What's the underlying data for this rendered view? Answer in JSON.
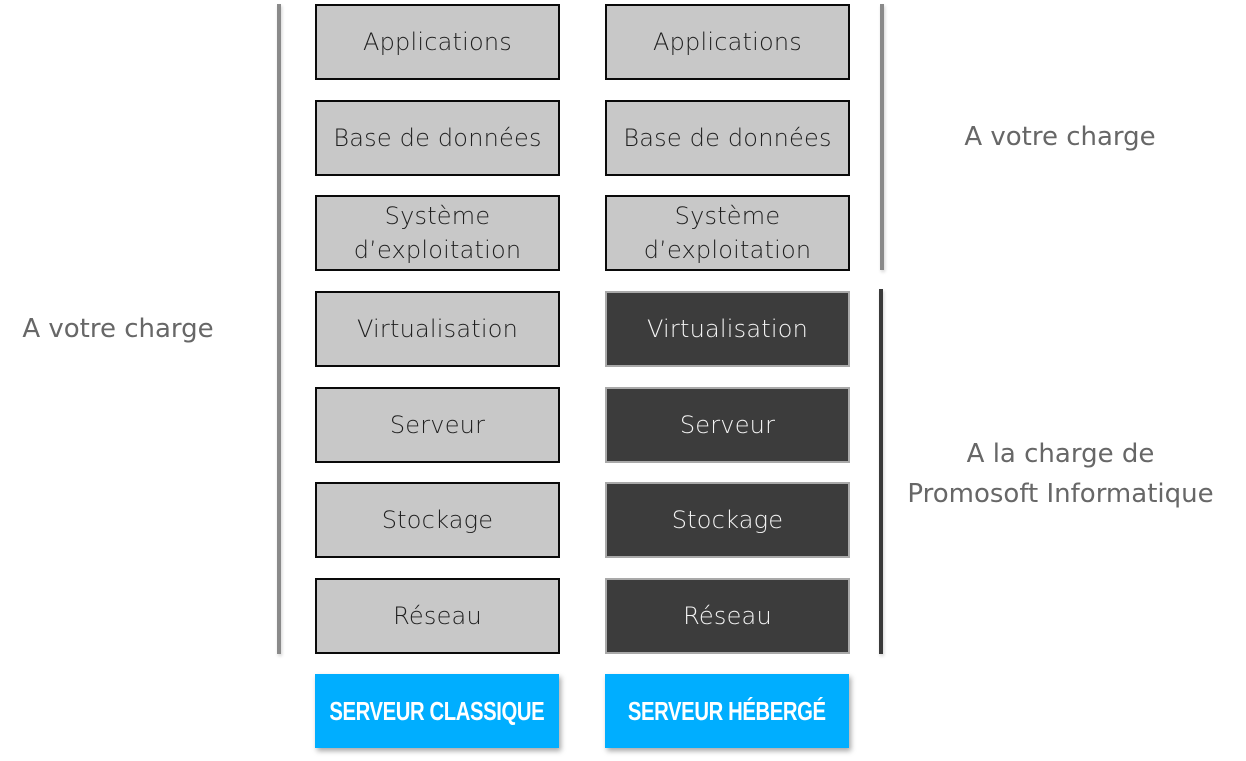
{
  "columns": [
    {
      "title": "SERVEUR CLASSIQUE",
      "layers": [
        {
          "label": "Applications",
          "responsibility": "client"
        },
        {
          "label": "Base de données",
          "responsibility": "client"
        },
        {
          "label": "Système\nd’exploitation",
          "responsibility": "client"
        },
        {
          "label": "Virtualisation",
          "responsibility": "client"
        },
        {
          "label": "Serveur",
          "responsibility": "client"
        },
        {
          "label": "Stockage",
          "responsibility": "client"
        },
        {
          "label": "Réseau",
          "responsibility": "client"
        }
      ]
    },
    {
      "title": "SERVEUR HÉBERGÉ",
      "layers": [
        {
          "label": "Applications",
          "responsibility": "client"
        },
        {
          "label": "Base de données",
          "responsibility": "client"
        },
        {
          "label": "Système\nd’exploitation",
          "responsibility": "client"
        },
        {
          "label": "Virtualisation",
          "responsibility": "provider"
        },
        {
          "label": "Serveur",
          "responsibility": "provider"
        },
        {
          "label": "Stockage",
          "responsibility": "provider"
        },
        {
          "label": "Réseau",
          "responsibility": "provider"
        }
      ]
    }
  ],
  "labels": {
    "left": "A votre charge",
    "right_top": "A votre charge",
    "right_bottom_line1": "A la charge de",
    "right_bottom_line2": "Promosoft Informatique"
  },
  "colors": {
    "client_box": "#c8c8c8",
    "provider_box": "#3c3c3c",
    "footer_accent": "#00aeff",
    "label_text": "#676767"
  }
}
